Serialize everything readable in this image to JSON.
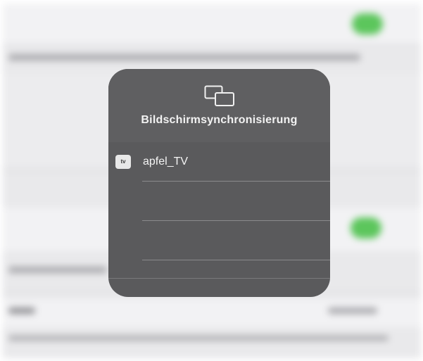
{
  "screen_mirroring": {
    "title": "Bildschirmsynchronisierung",
    "icon": "screen-mirroring-icon",
    "devices": [
      {
        "badge": "tv",
        "name": "apfel_TV"
      },
      {
        "badge": "",
        "name": ""
      },
      {
        "badge": "",
        "name": ""
      }
    ]
  },
  "colors": {
    "panel": "#5a5a5c",
    "toggle_on": "#5cc65c",
    "background": "#e9e9eb"
  }
}
